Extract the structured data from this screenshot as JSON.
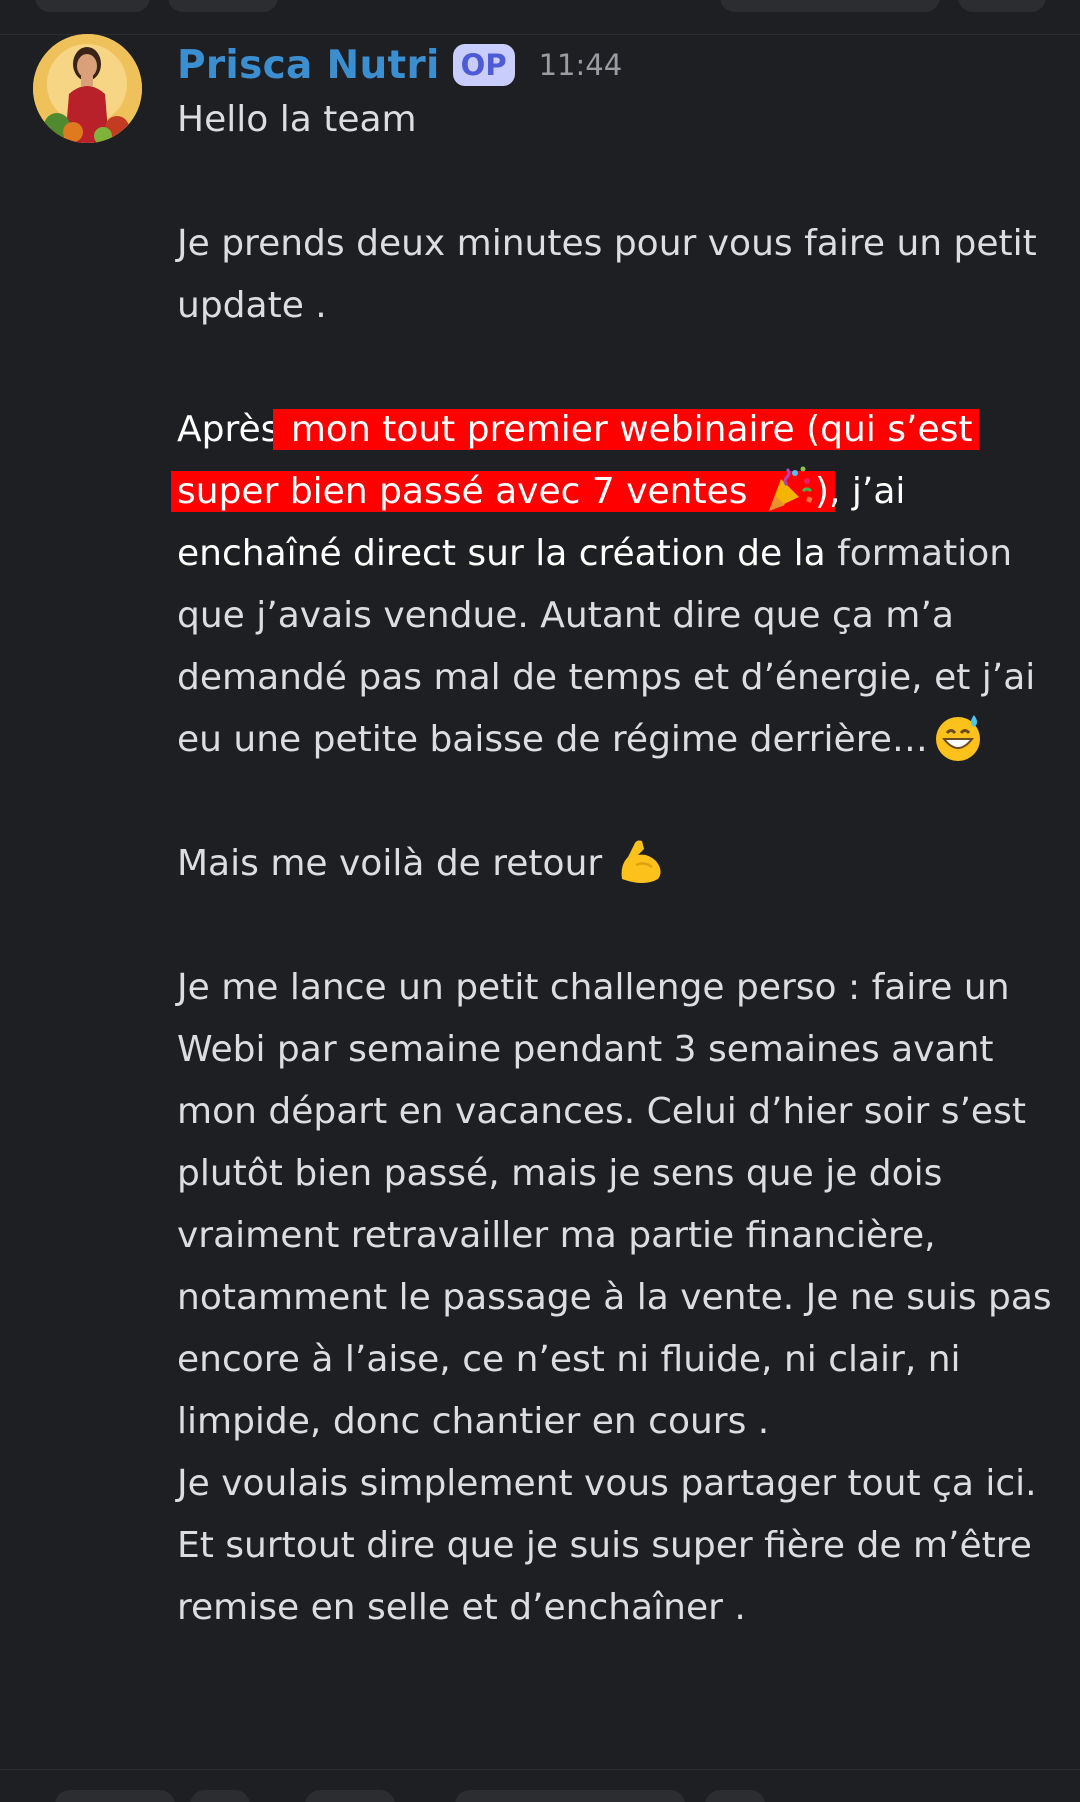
{
  "message": {
    "author": "Prisca Nutri",
    "badge": "OP",
    "time": "11:44",
    "greeting": "Hello la team",
    "p2": "Je prends deux minutes pour vous faire un petit update .",
    "p3_pre": "Après",
    "p3_highlight": " mon tout premier webinaire (qui s’est super bien passé avec 7 ventes ",
    "p3_emoji": "party-popper-icon",
    "p3_hl_end": ")",
    "p3_white_rest": ", j’ai enchaîné direct sur la création de la ",
    "p3_rest": "formation que j’avais vendue. Autant dire que ça m’a demandé pas mal de temps et d’énergie, et j’ai eu une petite baisse de régime derrière…",
    "p3_end_emoji": "grinning-sweat-icon",
    "p4": "Mais me voilà de retour",
    "p4_emoji": "flexed-biceps-icon",
    "p5": "Je me lance un petit challenge perso : faire un Webi par semaine pendant 3 semaines avant mon départ en vacances. Celui d’hier soir s’est plutôt bien passé, mais je sens que je dois vraiment retravailler ma partie financière, notamment le passage à la vente. Je ne suis pas encore à l’aise, ce n’est ni fluide, ni clair, ni limpide, donc chantier en cours .",
    "p6": "Je voulais simplement vous partager tout ça ici. Et surtout dire que je suis super fière de m’être remise en selle et d’enchaîner ."
  },
  "colors": {
    "background": "#1e1f22",
    "username": "#3b8fd1",
    "badge_bg": "#c9cdfb",
    "badge_text": "#4e5bd6",
    "highlight": "#ff0000",
    "text": "#dcdde1"
  }
}
